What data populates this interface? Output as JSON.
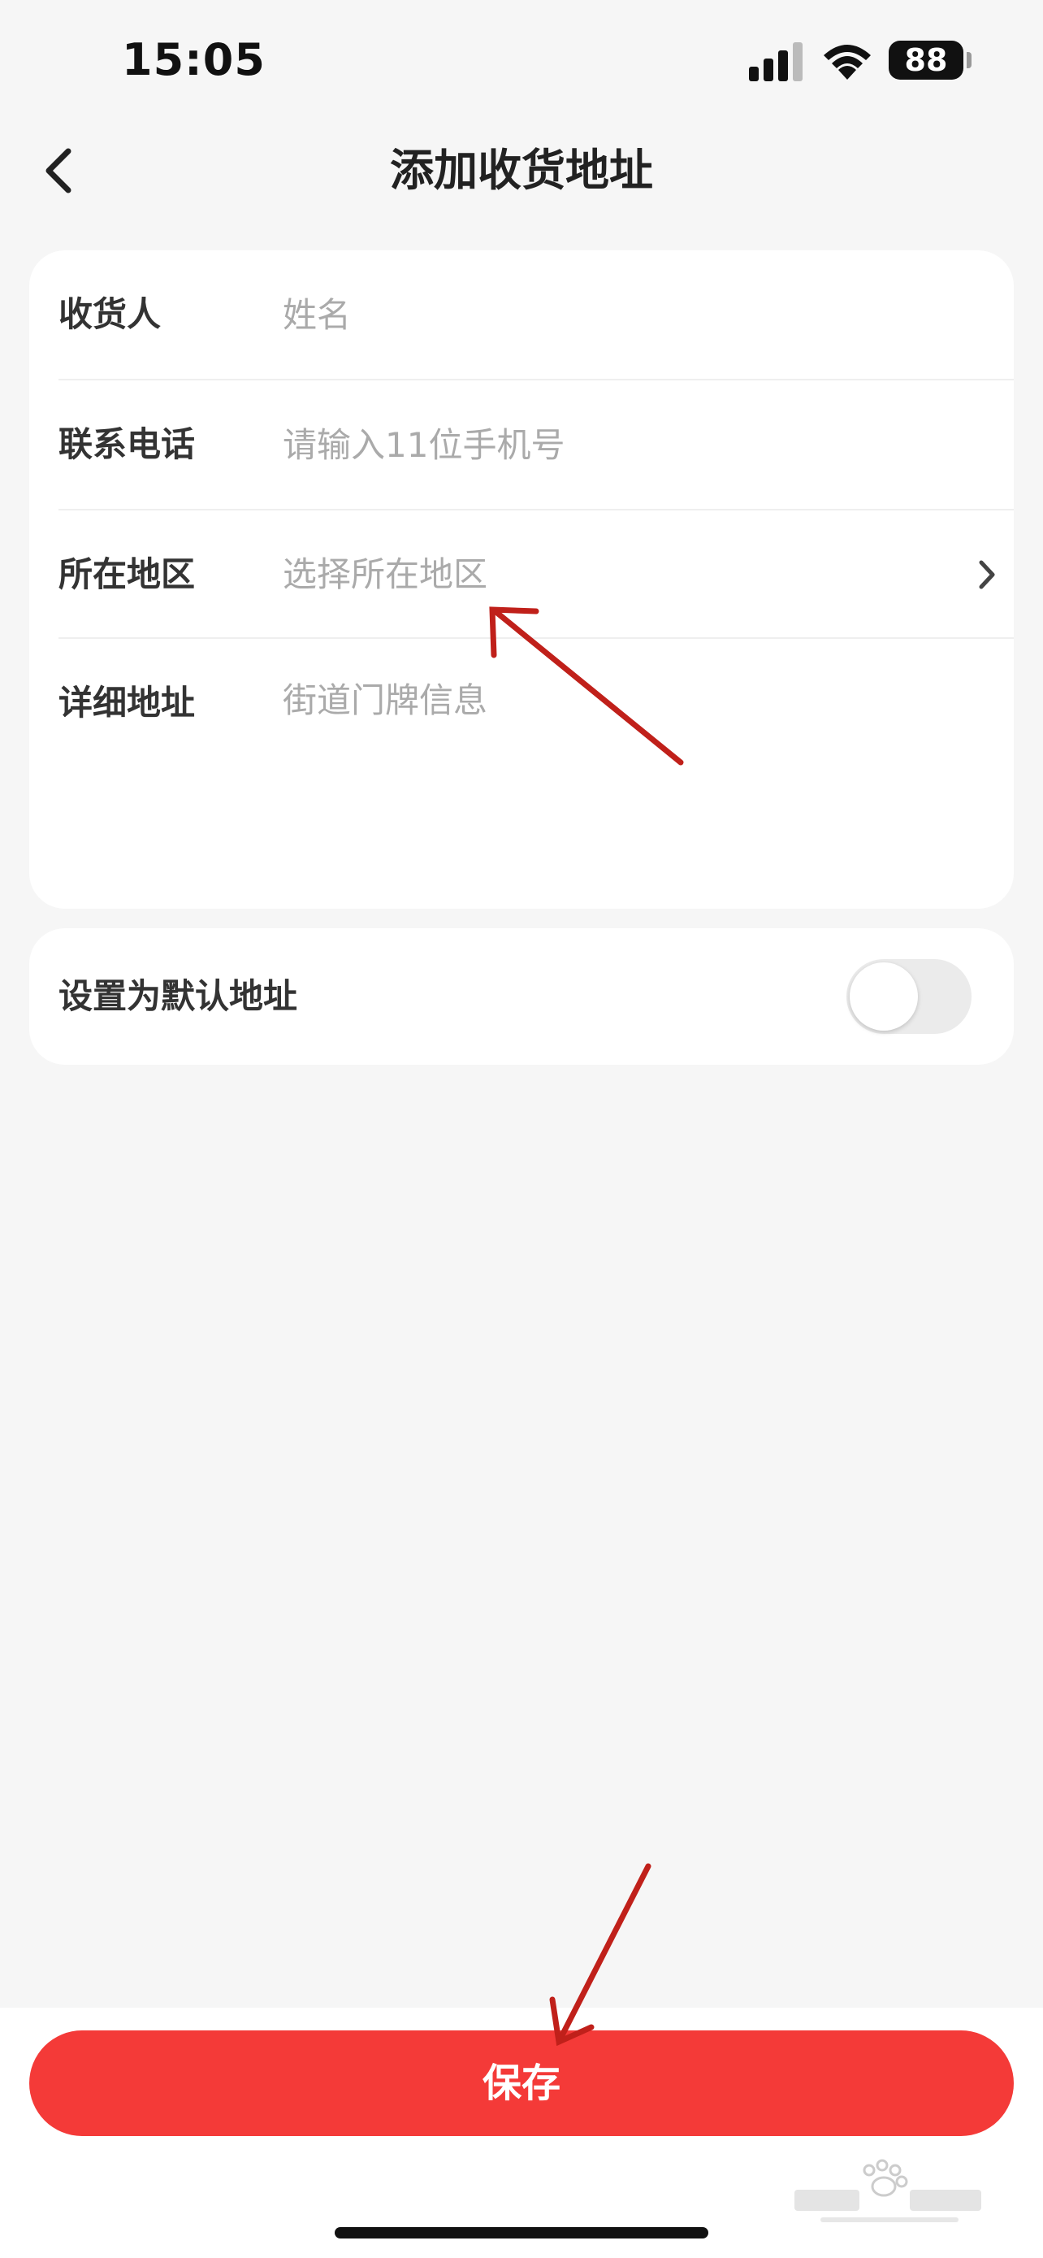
{
  "status_bar": {
    "time": "15:05",
    "battery": "88"
  },
  "header": {
    "title": "添加收货地址"
  },
  "form": {
    "recipient": {
      "label": "收货人",
      "placeholder": "姓名"
    },
    "phone": {
      "label": "联系电话",
      "placeholder": "请输入11位手机号"
    },
    "region": {
      "label": "所在地区",
      "placeholder": "选择所在地区"
    },
    "detail": {
      "label": "详细地址",
      "placeholder": "街道门牌信息"
    }
  },
  "default_address": {
    "label": "设置为默认地址",
    "enabled": false
  },
  "footer": {
    "save_label": "保存"
  },
  "colors": {
    "accent": "#f43a38",
    "annotation": "#c0201a",
    "background": "#f6f6f6"
  },
  "icons": [
    "signal-icon",
    "wifi-icon",
    "battery-icon",
    "back-arrow-icon",
    "chevron-right-icon",
    "baidu-jingyan-watermark"
  ]
}
